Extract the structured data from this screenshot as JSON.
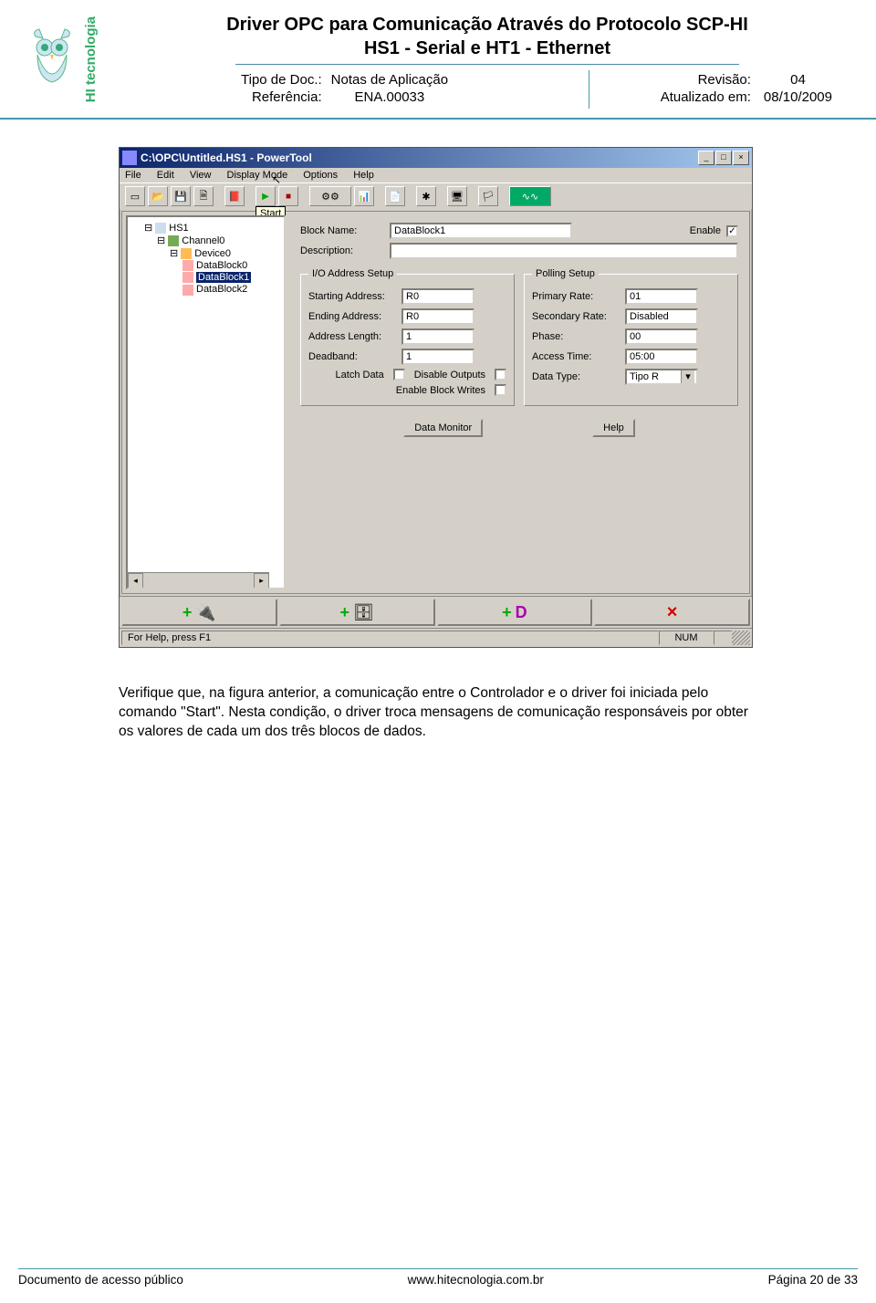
{
  "header": {
    "title1": "Driver OPC para Comunicação Através do Protocolo SCP-HI",
    "title2": "HS1 - Serial e HT1 - Ethernet",
    "logo_text": "HI tecnologia",
    "tipo_label": "Tipo de Doc.:",
    "tipo_value": "Notas de Aplicação",
    "ref_label": "Referência:",
    "ref_value": "ENA.00033",
    "rev_label": "Revisão:",
    "rev_value": "04",
    "upd_label": "Atualizado em:",
    "upd_value": "08/10/2009"
  },
  "win": {
    "title": "C:\\OPC\\Untitled.HS1 - PowerTool",
    "menu": [
      "File",
      "Edit",
      "View",
      "Display Mode",
      "Options",
      "Help"
    ],
    "tooltip": "Start",
    "tree": {
      "root": "HS1",
      "channel": "Channel0",
      "device": "Device0",
      "blocks": [
        "DataBlock0",
        "DataBlock1",
        "DataBlock2"
      ],
      "selected_index": 1
    },
    "form": {
      "block_name_label": "Block Name:",
      "block_name": "DataBlock1",
      "enable_label": "Enable",
      "desc_label": "Description:",
      "desc": "",
      "group_io": "I/O Address Setup",
      "start_addr_label": "Starting Address:",
      "start_addr": "R0",
      "end_addr_label": "Ending Address:",
      "end_addr": "R0",
      "addr_len_label": "Address Length:",
      "addr_len": "1",
      "deadband_label": "Deadband:",
      "deadband": "1",
      "latch_label": "Latch Data",
      "disable_out_label": "Disable Outputs",
      "enable_bw_label": "Enable Block Writes",
      "group_poll": "Polling Setup",
      "primary_label": "Primary Rate:",
      "primary": "01",
      "secondary_label": "Secondary Rate:",
      "secondary": "Disabled",
      "phase_label": "Phase:",
      "phase": "00",
      "access_label": "Access Time:",
      "access": "05:00",
      "datatype_label": "Data Type:",
      "datatype": "Tipo R",
      "btn_monitor": "Data Monitor",
      "btn_help": "Help"
    },
    "status_left": "For Help, press F1",
    "status_num": "NUM"
  },
  "body_text": "Verifique que, na figura anterior, a comunicação entre o Controlador e o driver foi iniciada pelo comando \"Start\". Nesta condição, o driver troca mensagens de comunicação responsáveis por obter os valores de cada um dos três blocos de dados.",
  "footer": {
    "left": "Documento de acesso público",
    "center": "www.hitecnologia.com.br",
    "right": "Página 20 de 33"
  }
}
